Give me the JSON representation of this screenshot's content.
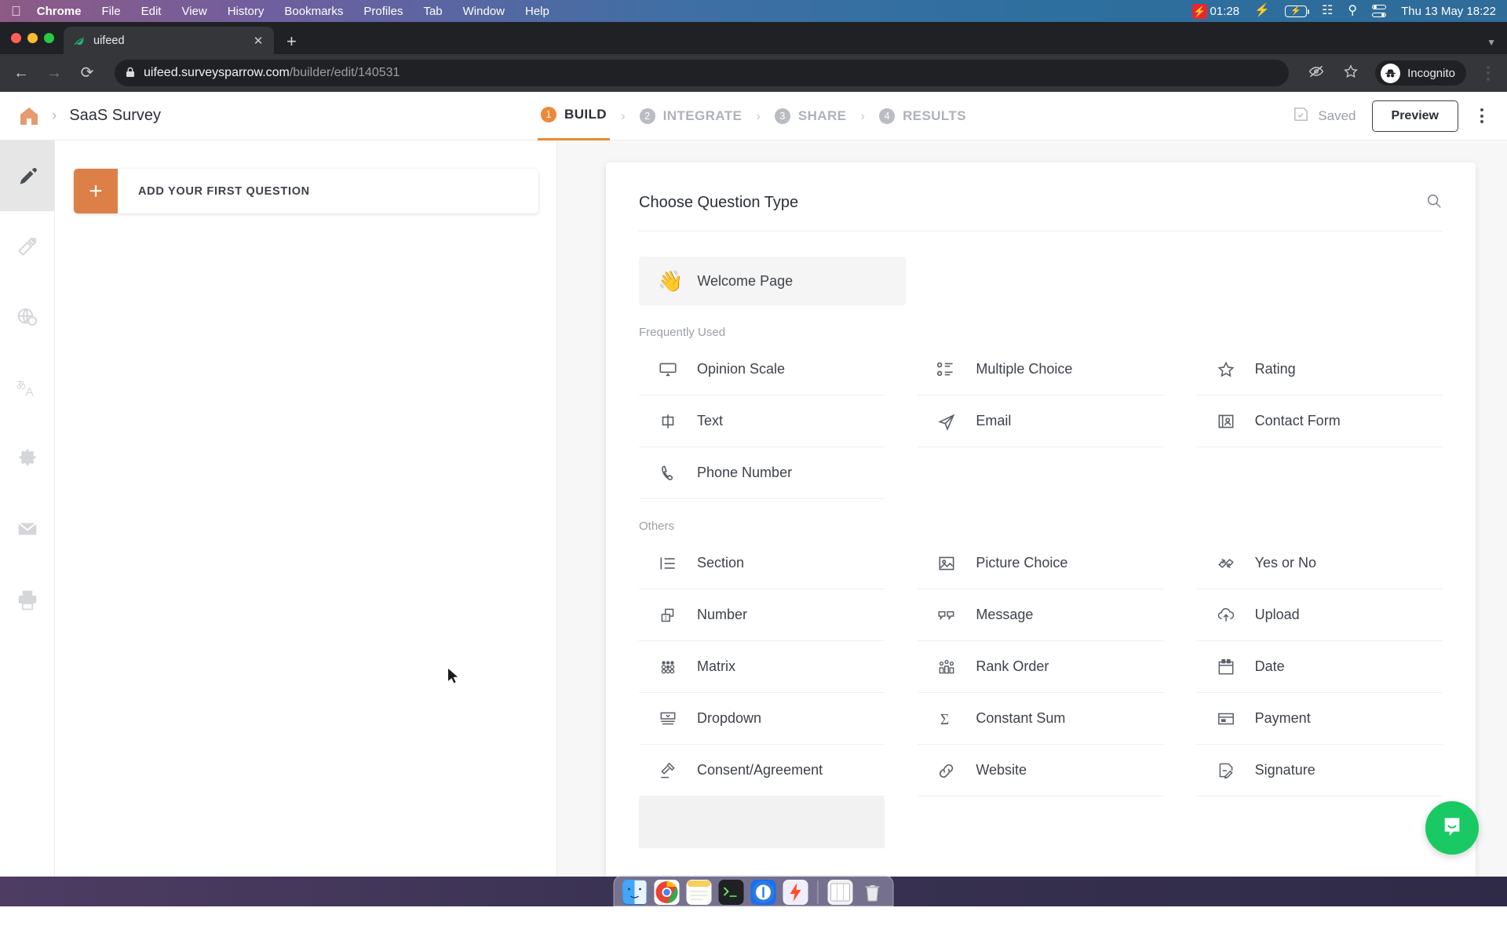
{
  "menubar": {
    "apple": "",
    "items": [
      {
        "label": "Chrome",
        "bold": true
      },
      {
        "label": "File",
        "bold": false
      },
      {
        "label": "Edit",
        "bold": false
      },
      {
        "label": "View",
        "bold": false
      },
      {
        "label": "History",
        "bold": false
      },
      {
        "label": "Bookmarks",
        "bold": false
      },
      {
        "label": "Profiles",
        "bold": false
      },
      {
        "label": "Tab",
        "bold": false
      },
      {
        "label": "Window",
        "bold": false
      },
      {
        "label": "Help",
        "bold": false
      }
    ],
    "timer": "01:28",
    "battery_percent": "",
    "datetime": "Thu 13 May  18:22"
  },
  "browser": {
    "tab_title": "uifeed",
    "tab_close": "✕",
    "new_tab": "+",
    "url_domain": "uifeed.surveysparrow.com",
    "url_path": "/builder/edit/140531",
    "profile_label": "Incognito",
    "back": "←",
    "forward": "→",
    "reload": "⟳",
    "lock": "🔒"
  },
  "header": {
    "breadcrumb_separator": "›",
    "survey_title": "SaaS Survey",
    "steps": [
      {
        "num": "1",
        "label": "BUILD",
        "active": true
      },
      {
        "num": "2",
        "label": "INTEGRATE",
        "active": false
      },
      {
        "num": "3",
        "label": "SHARE",
        "active": false
      },
      {
        "num": "4",
        "label": "RESULTS",
        "active": false
      }
    ],
    "step_arrow": "›",
    "saved_label": "Saved",
    "preview_label": "Preview"
  },
  "rail": {
    "items": [
      {
        "name": "build-pencil",
        "active": true
      },
      {
        "name": "theme-brush",
        "active": false
      },
      {
        "name": "globe",
        "active": false
      },
      {
        "name": "translate",
        "active": false
      },
      {
        "name": "settings-gear",
        "active": false
      },
      {
        "name": "email",
        "active": false
      },
      {
        "name": "print",
        "active": false
      }
    ]
  },
  "left_pane": {
    "add_question_plus": "+",
    "add_question_label": "ADD YOUR FIRST QUESTION"
  },
  "question_panel": {
    "title": "Choose Question Type",
    "search_icon": "search-icon",
    "welcome": {
      "emoji": "👋",
      "label": "Welcome Page"
    },
    "groups": [
      {
        "title": "Frequently Used",
        "items": [
          {
            "label": "Opinion Scale",
            "icon": "opinion-scale-icon"
          },
          {
            "label": "Multiple Choice",
            "icon": "multiple-choice-icon"
          },
          {
            "label": "Rating",
            "icon": "star-icon"
          },
          {
            "label": "Text",
            "icon": "text-icon"
          },
          {
            "label": "Email",
            "icon": "paper-plane-icon"
          },
          {
            "label": "Contact Form",
            "icon": "contact-card-icon"
          },
          {
            "label": "Phone Number",
            "icon": "phone-icon"
          },
          {
            "label": "",
            "icon": ""
          },
          {
            "label": "",
            "icon": ""
          }
        ]
      },
      {
        "title": "Others",
        "items": [
          {
            "label": "Section",
            "icon": "section-icon"
          },
          {
            "label": "Picture Choice",
            "icon": "picture-icon"
          },
          {
            "label": "Yes or No",
            "icon": "thumbs-icon"
          },
          {
            "label": "Number",
            "icon": "number-icon"
          },
          {
            "label": "Message",
            "icon": "message-icon"
          },
          {
            "label": "Upload",
            "icon": "upload-icon"
          },
          {
            "label": "Matrix",
            "icon": "matrix-icon"
          },
          {
            "label": "Rank Order",
            "icon": "rank-order-icon"
          },
          {
            "label": "Date",
            "icon": "calendar-icon"
          },
          {
            "label": "Dropdown",
            "icon": "dropdown-icon"
          },
          {
            "label": "Constant Sum",
            "icon": "sigma-icon"
          },
          {
            "label": "Payment",
            "icon": "card-icon"
          },
          {
            "label": "Consent/Agreement",
            "icon": "gavel-icon"
          },
          {
            "label": "Website",
            "icon": "link-icon"
          },
          {
            "label": "Signature",
            "icon": "signature-icon"
          }
        ]
      }
    ]
  },
  "intercom": {
    "label": "chat-bubble-icon"
  },
  "dock": {
    "items": [
      {
        "name": "finder"
      },
      {
        "name": "chrome"
      },
      {
        "name": "notes"
      },
      {
        "name": "terminal"
      },
      {
        "name": "1password"
      },
      {
        "name": "bolt-app"
      },
      {
        "name": "window-stack"
      },
      {
        "name": "trash"
      }
    ]
  },
  "colors": {
    "accent": "#dd8047",
    "active_step": "#ed8936",
    "intercom_green": "#18c964"
  }
}
